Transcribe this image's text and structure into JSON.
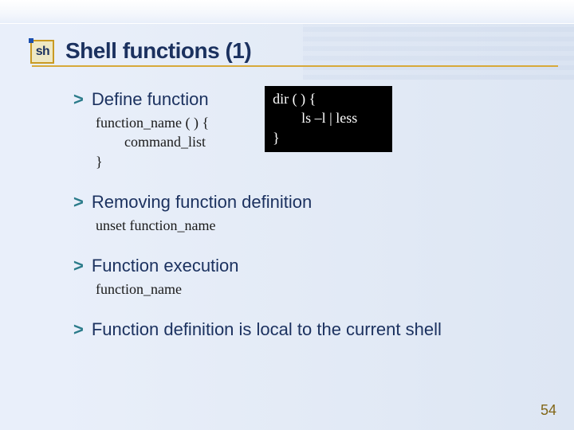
{
  "icon": {
    "glyph": "sh"
  },
  "title": "Shell functions (1)",
  "bullets": {
    "define": {
      "heading": "Define function",
      "syntax": "function_name ( ) {\n        command_list\n}",
      "example": "dir ( ) {\n        ls –l | less\n}"
    },
    "remove": {
      "heading": "Removing function definition",
      "syntax": "unset function_name"
    },
    "exec": {
      "heading": "Function execution",
      "syntax": "function_name"
    },
    "local": {
      "heading": "Function definition is local to the current shell"
    }
  },
  "page_number": "54"
}
